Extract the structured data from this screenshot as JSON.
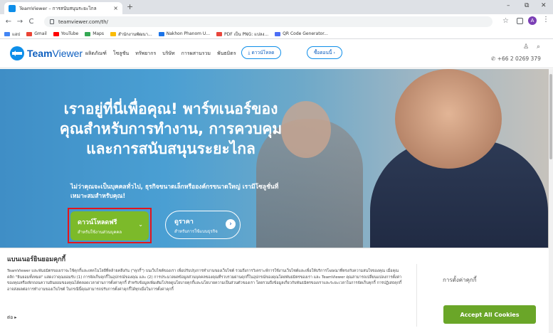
{
  "browser": {
    "tab_title": "TeamViewer – การสนับสนุนระยะไกล",
    "tab_close": "×",
    "new_tab": "+",
    "win_min": "–",
    "win_restore": "⧉",
    "win_close": "✕",
    "back": "←",
    "forward": "→",
    "reload": "C",
    "url": "teamviewer.com/th/",
    "star": "☆",
    "profile_initial": "A",
    "menu": "⋮",
    "bookmarks": [
      {
        "label": "แอป",
        "color": "#4285f4"
      },
      {
        "label": "Gmail",
        "color": "#ea4335"
      },
      {
        "label": "YouTube",
        "color": "#ff0000"
      },
      {
        "label": "Maps",
        "color": "#34a853"
      },
      {
        "label": "สำนักงานพัฒนา...",
        "color": "#fbbc05"
      },
      {
        "label": "Nakhon Phanom U...",
        "color": "#1a73e8"
      },
      {
        "label": "PDF เป็น PNG: แปลง...",
        "color": "#e8453c"
      },
      {
        "label": "QR Code Generator...",
        "color": "#4c6ef5"
      }
    ]
  },
  "site": {
    "logo_bold": "Team",
    "logo_light": "Viewer",
    "nav": [
      "ผลิตภัณฑ์",
      "โซลูชัน",
      "ทรัพยากร",
      "บริษัท",
      "การผสานรวม",
      "พันธมิตร"
    ],
    "download_btn": "⤓ ดาวน์โหลด",
    "buy_btn": "ซื้อตอนนี้ ›",
    "user_icon": "♙",
    "search_icon": "⌕",
    "phone": "+66 2 0269 379",
    "phone_icon": "✆"
  },
  "hero": {
    "headline": "เราอยู่ที่นี่เพื่อคุณ! พาร์ทเนอร์ของคุณสำหรับการทำงาน, การควบคุมและการสนับสนุนระยะไกล",
    "subtext": "ไม่ว่าคุณจะเป็นบุคคลทั่วไป, ธุรกิจขนาดเล็กหรือองค์กรขนาดใหญ่ เรามีโซลูชั่นที่เหมาะสมสำหรับคุณ!",
    "download_label": "ดาวน์โหลดฟรี",
    "download_sub": "สำหรับใช้งานส่วนบุคคล",
    "download_chev": "⌄",
    "price_label": "ดูราคา",
    "price_sub": "สำหรับการใช้แบบธุรกิจ",
    "price_arrow": "›"
  },
  "cookie": {
    "title": "แบนเนอร์ยินยอมคุกกี้",
    "body": "TeamViewer และพันธมิตรของเราจะใช้คุกกี้และเทคโนโลยีที่คล้ายคลึงกัน (\"คุกกี้\") บนเว็บไซต์ของเรา เพื่อปรับปรุงการทำงานของเว็บไซต์ รวมถึงการวิเคราะห์การใช้งานเว็บไซต์และเพื่อให้บริการโฆษณาที่ตรงกับความสนใจของคุณ เมื่อคุณคลิก \"ยินยอมทั้งหมด\" แสดงว่าคุณยอมรับ (1) การจัดเก็บคุกกี้ในอุปกรณ์ของคุณ และ (2) การประมวลผลข้อมูลส่วนบุคคลของคุณที่รวบรวมผ่านคุกกี้ในอุปกรณ์ของคุณโดยพันธมิตรของเรา และ TeamViewer คุณสามารถเปลี่ยนแปลงการตั้งค่าของคุณหรือเพิกถอนความยินยอมของคุณได้ตลอดเวลาผ่านการตั้งค่าคุกกี้ สำหรับข้อมูลเพิ่มเติมโปรดดูนโยบายคุกกี้และนโยบายความเป็นส่วนตัวของเรา โดยรวมถึงข้อมูลเกี่ยวกับพันธมิตรของเราและระยะเวลาในการจัดเก็บคุกกี้ การปฏิเสธคุกกี้อาจส่งผลต่อการทำงานของเว็บไซต์ ในกรณีนี้คุณสามารถปรับการตั้งค่าคุกกี้ได้ทุกเมื่อในการตั้งค่าคุกกี้",
    "more": "ต่อ ▸",
    "prefs": "การตั้งค่าคุกกี้",
    "accept": "Accept All Cookies"
  }
}
